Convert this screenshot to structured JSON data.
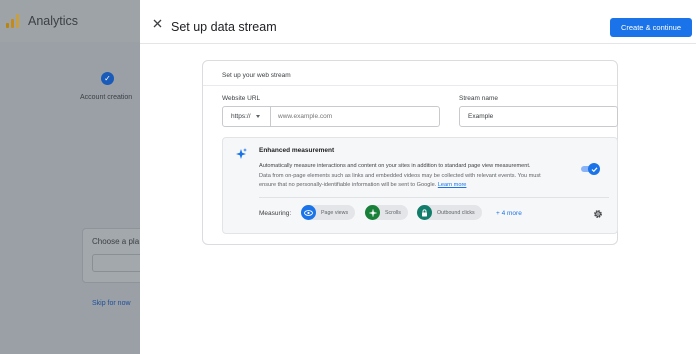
{
  "background": {
    "app_title": "Analytics",
    "step_label": "Account creation",
    "card_label": "Choose a pla",
    "skip_label": "Skip for now"
  },
  "drawer": {
    "title": "Set up data stream",
    "primary_button": "Create & continue"
  },
  "card": {
    "heading": "Set up your web stream",
    "website_url": {
      "label": "Website URL",
      "protocol": "https://",
      "placeholder": "www.example.com"
    },
    "stream_name": {
      "label": "Stream name",
      "value": "Example"
    },
    "enhanced_measurement": {
      "title": "Enhanced measurement",
      "description_line1": "Automatically measure interactions and content on your sites in addition to standard page view measurement.",
      "description_line2": "Data from on-page elements such as links and embedded videos may be collected with relevant events. You must",
      "description_line3": "ensure that no personally-identifiable information will be sent to Google.",
      "learn_more": "Learn more",
      "toggle_on": true,
      "measuring_label": "Measuring:",
      "chips": [
        {
          "label": "Page views",
          "icon": "eye-icon",
          "color": "#1a73e8"
        },
        {
          "label": "Scrolls",
          "icon": "crosshair-icon",
          "color": "#188038"
        },
        {
          "label": "Outbound clicks",
          "icon": "lock-icon",
          "color": "#137d6b"
        }
      ],
      "more_link": "+ 4 more"
    }
  },
  "colors": {
    "accent": "#1a73e8",
    "overlay": "#9aa0a6"
  }
}
